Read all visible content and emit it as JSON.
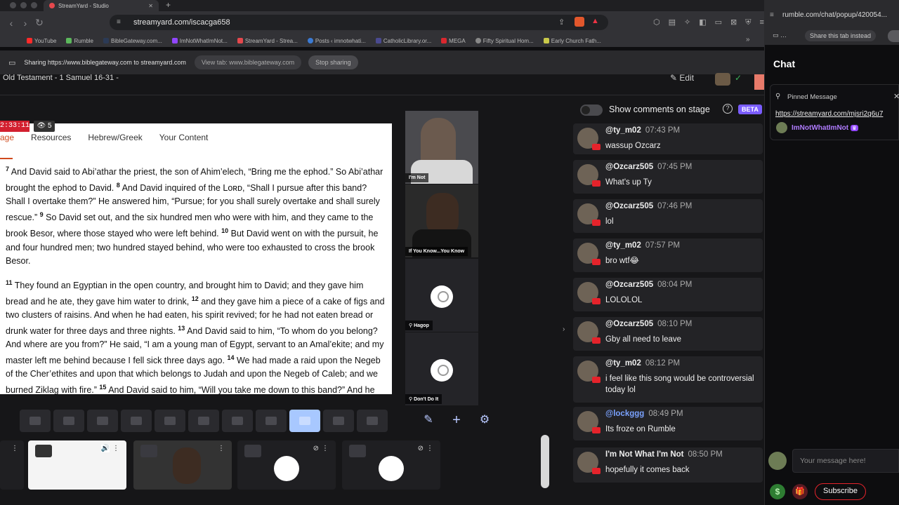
{
  "browser": {
    "tab_title": "StreamYard - Studio",
    "new_tab": "+",
    "url": "streamyard.com/iscacga658",
    "bookmarks": [
      "YouTube",
      "Rumble",
      "BibleGateway.com...",
      "ImNotWhatImNot...",
      "StreamYard - Strea...",
      "Posts ‹ imnotwhati...",
      "CatholicLibrary.or...",
      "MEGA",
      "Fifty Spiritual Hom...",
      "Early Church Fath..."
    ],
    "bookmark_colors": [
      "#ff2a2a",
      "#5cb85c",
      "#2b3a55",
      "#9146ff",
      "#e5484d",
      "#3b7bd4",
      "#4a4a90",
      "#d9272e",
      "#888888",
      "#c9c94a"
    ]
  },
  "sharebar": {
    "text": "Sharing https://www.biblegateway.com to streamyard.com",
    "view_tab": "View tab: www.biblegateway.com",
    "stop": "Stop sharing"
  },
  "studio": {
    "title": "Old Testament - 1 Samuel 16-31 -",
    "edit": "Edit",
    "timer": "2:33:11",
    "viewers": "5",
    "show_comments": "Show comments on stage",
    "beta": "BETA"
  },
  "doc": {
    "nav": [
      "age",
      "Resources",
      "Hebrew/Greek",
      "Your Content"
    ],
    "paragraphs": [
      [
        {
          "n": "7",
          "t": " And David said to Abi’athar the priest, the son of Ahim’elech, “Bring me the ephod.” So Abi’athar brought the ephod to David. "
        },
        {
          "n": "8",
          "t": " And David inquired of the Lᴏʀᴅ, “Shall I pursue after this band? Shall I overtake them?” He answered him, “Pursue; for you shall surely overtake and shall surely rescue.” "
        },
        {
          "n": "9",
          "t": " So David set out, and the six hundred men who were with him, and they came to the brook Besor, where those stayed who were left behind. "
        },
        {
          "n": "10",
          "t": " But David went on with the pursuit, he and four hundred men; two hundred stayed behind, who were too exhausted to cross the brook Besor."
        }
      ],
      [
        {
          "n": "11",
          "t": " They found an Egyptian in the open country, and brought him to David; and they gave him bread and he ate, they gave him water to drink, "
        },
        {
          "n": "12",
          "t": " and they gave him a piece of a cake of figs and two clusters of raisins. And when he had eaten, his spirit revived; for he had not eaten bread or drunk water for three days and three nights. "
        },
        {
          "n": "13",
          "t": " And David said to him, “To whom do you belong? And where are you from?” He said, “I am a young man of Egypt, servant to an Amal’ekite; and my master left me behind because I fell sick three days ago. "
        },
        {
          "n": "14",
          "t": " We had made a raid upon the Negeb of the Cher’ethites and upon that which belongs to Judah and upon the Negeb of Caleb; and we burned Ziklag with fire.” "
        },
        {
          "n": "15",
          "t": " And David said to him, “Will you take me down to this band?” And he said, “Swear to me by God, that you will not kill me, or deliver me into the hands of my master, and I will take you down to this band.”"
        }
      ]
    ]
  },
  "cams": [
    {
      "label": "I'm Not",
      "bg": "#4a4a4e"
    },
    {
      "label": "If You Know...You Know",
      "bg": "#2a2a2a"
    },
    {
      "label": "Hagop",
      "bg": "#242428"
    },
    {
      "label": "Don't Do It",
      "bg": "#242428"
    }
  ],
  "comments": [
    {
      "name": "@ty_m02",
      "time": "07:43 PM",
      "text": "wassup Ozcarz"
    },
    {
      "name": "@Ozcarz505",
      "time": "07:45 PM",
      "text": "What's up Ty"
    },
    {
      "name": "@Ozcarz505",
      "time": "07:46 PM",
      "text": "lol"
    },
    {
      "name": "@ty_m02",
      "time": "07:57 PM",
      "text": "bro wtf😂"
    },
    {
      "name": "@Ozcarz505",
      "time": "08:04 PM",
      "text": "LOLOLOL"
    },
    {
      "name": "@Ozcarz505",
      "time": "08:10 PM",
      "text": "Gby all need to leave"
    },
    {
      "name": "@ty_m02",
      "time": "08:12 PM",
      "text": "i feel like this song would be controversial today lol"
    },
    {
      "name": "@lockggg",
      "time": "08:49 PM",
      "text": "Its froze on Rumble"
    },
    {
      "name": "I'm Not What I'm Not",
      "time": "08:50 PM",
      "text": "hopefully it comes back"
    }
  ],
  "chat": {
    "url": "rumble.com/chat/popup/420054...",
    "share_tab": "Share this tab instead",
    "title": "Chat",
    "pinned_label": "Pinned Message",
    "pinned_link": "https://streamyard.com/mjsri2q6u7",
    "pinned_user": "ImNotWhatImNot",
    "input_placeholder": "Your message here!",
    "subscribe": "Subscribe"
  }
}
